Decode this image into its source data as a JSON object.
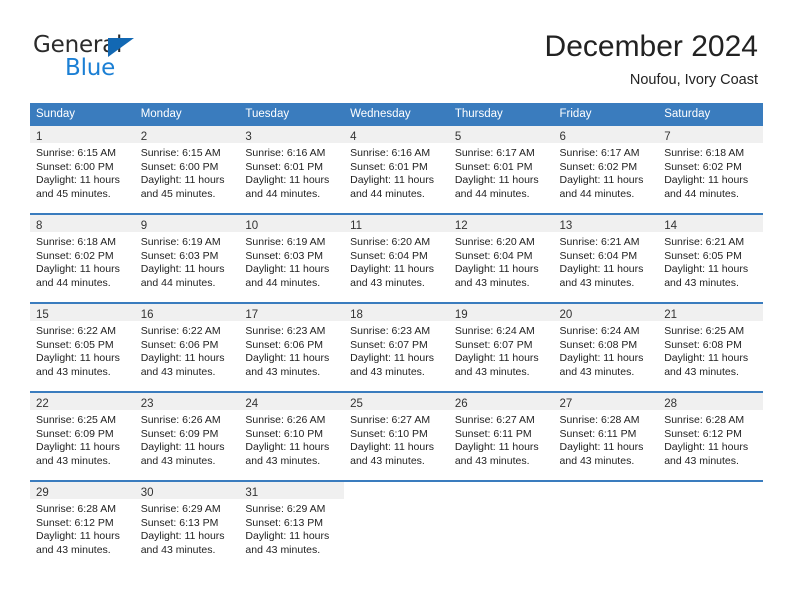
{
  "brand": {
    "name_top": "General",
    "name_bottom": "Blue",
    "accent_color": "#1b7fd4",
    "triangle_color": "#1268b3"
  },
  "header": {
    "title": "December 2024",
    "subtitle": "Noufou, Ivory Coast"
  },
  "theme": {
    "header_row_bg": "#3a7cbe",
    "daynum_band_bg": "#f0f0f0",
    "week_separator": "#3a7cbe",
    "text": "#222222"
  },
  "weekdays": [
    "Sunday",
    "Monday",
    "Tuesday",
    "Wednesday",
    "Thursday",
    "Friday",
    "Saturday"
  ],
  "weeks": [
    {
      "days": [
        {
          "num": "1",
          "sunrise": "Sunrise: 6:15 AM",
          "sunset": "Sunset: 6:00 PM",
          "daylight1": "Daylight: 11 hours",
          "daylight2": "and 45 minutes."
        },
        {
          "num": "2",
          "sunrise": "Sunrise: 6:15 AM",
          "sunset": "Sunset: 6:00 PM",
          "daylight1": "Daylight: 11 hours",
          "daylight2": "and 45 minutes."
        },
        {
          "num": "3",
          "sunrise": "Sunrise: 6:16 AM",
          "sunset": "Sunset: 6:01 PM",
          "daylight1": "Daylight: 11 hours",
          "daylight2": "and 44 minutes."
        },
        {
          "num": "4",
          "sunrise": "Sunrise: 6:16 AM",
          "sunset": "Sunset: 6:01 PM",
          "daylight1": "Daylight: 11 hours",
          "daylight2": "and 44 minutes."
        },
        {
          "num": "5",
          "sunrise": "Sunrise: 6:17 AM",
          "sunset": "Sunset: 6:01 PM",
          "daylight1": "Daylight: 11 hours",
          "daylight2": "and 44 minutes."
        },
        {
          "num": "6",
          "sunrise": "Sunrise: 6:17 AM",
          "sunset": "Sunset: 6:02 PM",
          "daylight1": "Daylight: 11 hours",
          "daylight2": "and 44 minutes."
        },
        {
          "num": "7",
          "sunrise": "Sunrise: 6:18 AM",
          "sunset": "Sunset: 6:02 PM",
          "daylight1": "Daylight: 11 hours",
          "daylight2": "and 44 minutes."
        }
      ]
    },
    {
      "days": [
        {
          "num": "8",
          "sunrise": "Sunrise: 6:18 AM",
          "sunset": "Sunset: 6:02 PM",
          "daylight1": "Daylight: 11 hours",
          "daylight2": "and 44 minutes."
        },
        {
          "num": "9",
          "sunrise": "Sunrise: 6:19 AM",
          "sunset": "Sunset: 6:03 PM",
          "daylight1": "Daylight: 11 hours",
          "daylight2": "and 44 minutes."
        },
        {
          "num": "10",
          "sunrise": "Sunrise: 6:19 AM",
          "sunset": "Sunset: 6:03 PM",
          "daylight1": "Daylight: 11 hours",
          "daylight2": "and 44 minutes."
        },
        {
          "num": "11",
          "sunrise": "Sunrise: 6:20 AM",
          "sunset": "Sunset: 6:04 PM",
          "daylight1": "Daylight: 11 hours",
          "daylight2": "and 43 minutes."
        },
        {
          "num": "12",
          "sunrise": "Sunrise: 6:20 AM",
          "sunset": "Sunset: 6:04 PM",
          "daylight1": "Daylight: 11 hours",
          "daylight2": "and 43 minutes."
        },
        {
          "num": "13",
          "sunrise": "Sunrise: 6:21 AM",
          "sunset": "Sunset: 6:04 PM",
          "daylight1": "Daylight: 11 hours",
          "daylight2": "and 43 minutes."
        },
        {
          "num": "14",
          "sunrise": "Sunrise: 6:21 AM",
          "sunset": "Sunset: 6:05 PM",
          "daylight1": "Daylight: 11 hours",
          "daylight2": "and 43 minutes."
        }
      ]
    },
    {
      "days": [
        {
          "num": "15",
          "sunrise": "Sunrise: 6:22 AM",
          "sunset": "Sunset: 6:05 PM",
          "daylight1": "Daylight: 11 hours",
          "daylight2": "and 43 minutes."
        },
        {
          "num": "16",
          "sunrise": "Sunrise: 6:22 AM",
          "sunset": "Sunset: 6:06 PM",
          "daylight1": "Daylight: 11 hours",
          "daylight2": "and 43 minutes."
        },
        {
          "num": "17",
          "sunrise": "Sunrise: 6:23 AM",
          "sunset": "Sunset: 6:06 PM",
          "daylight1": "Daylight: 11 hours",
          "daylight2": "and 43 minutes."
        },
        {
          "num": "18",
          "sunrise": "Sunrise: 6:23 AM",
          "sunset": "Sunset: 6:07 PM",
          "daylight1": "Daylight: 11 hours",
          "daylight2": "and 43 minutes."
        },
        {
          "num": "19",
          "sunrise": "Sunrise: 6:24 AM",
          "sunset": "Sunset: 6:07 PM",
          "daylight1": "Daylight: 11 hours",
          "daylight2": "and 43 minutes."
        },
        {
          "num": "20",
          "sunrise": "Sunrise: 6:24 AM",
          "sunset": "Sunset: 6:08 PM",
          "daylight1": "Daylight: 11 hours",
          "daylight2": "and 43 minutes."
        },
        {
          "num": "21",
          "sunrise": "Sunrise: 6:25 AM",
          "sunset": "Sunset: 6:08 PM",
          "daylight1": "Daylight: 11 hours",
          "daylight2": "and 43 minutes."
        }
      ]
    },
    {
      "days": [
        {
          "num": "22",
          "sunrise": "Sunrise: 6:25 AM",
          "sunset": "Sunset: 6:09 PM",
          "daylight1": "Daylight: 11 hours",
          "daylight2": "and 43 minutes."
        },
        {
          "num": "23",
          "sunrise": "Sunrise: 6:26 AM",
          "sunset": "Sunset: 6:09 PM",
          "daylight1": "Daylight: 11 hours",
          "daylight2": "and 43 minutes."
        },
        {
          "num": "24",
          "sunrise": "Sunrise: 6:26 AM",
          "sunset": "Sunset: 6:10 PM",
          "daylight1": "Daylight: 11 hours",
          "daylight2": "and 43 minutes."
        },
        {
          "num": "25",
          "sunrise": "Sunrise: 6:27 AM",
          "sunset": "Sunset: 6:10 PM",
          "daylight1": "Daylight: 11 hours",
          "daylight2": "and 43 minutes."
        },
        {
          "num": "26",
          "sunrise": "Sunrise: 6:27 AM",
          "sunset": "Sunset: 6:11 PM",
          "daylight1": "Daylight: 11 hours",
          "daylight2": "and 43 minutes."
        },
        {
          "num": "27",
          "sunrise": "Sunrise: 6:28 AM",
          "sunset": "Sunset: 6:11 PM",
          "daylight1": "Daylight: 11 hours",
          "daylight2": "and 43 minutes."
        },
        {
          "num": "28",
          "sunrise": "Sunrise: 6:28 AM",
          "sunset": "Sunset: 6:12 PM",
          "daylight1": "Daylight: 11 hours",
          "daylight2": "and 43 minutes."
        }
      ]
    },
    {
      "days": [
        {
          "num": "29",
          "sunrise": "Sunrise: 6:28 AM",
          "sunset": "Sunset: 6:12 PM",
          "daylight1": "Daylight: 11 hours",
          "daylight2": "and 43 minutes."
        },
        {
          "num": "30",
          "sunrise": "Sunrise: 6:29 AM",
          "sunset": "Sunset: 6:13 PM",
          "daylight1": "Daylight: 11 hours",
          "daylight2": "and 43 minutes."
        },
        {
          "num": "31",
          "sunrise": "Sunrise: 6:29 AM",
          "sunset": "Sunset: 6:13 PM",
          "daylight1": "Daylight: 11 hours",
          "daylight2": "and 43 minutes."
        },
        {
          "num": "",
          "sunrise": "",
          "sunset": "",
          "daylight1": "",
          "daylight2": ""
        },
        {
          "num": "",
          "sunrise": "",
          "sunset": "",
          "daylight1": "",
          "daylight2": ""
        },
        {
          "num": "",
          "sunrise": "",
          "sunset": "",
          "daylight1": "",
          "daylight2": ""
        },
        {
          "num": "",
          "sunrise": "",
          "sunset": "",
          "daylight1": "",
          "daylight2": ""
        }
      ]
    }
  ]
}
